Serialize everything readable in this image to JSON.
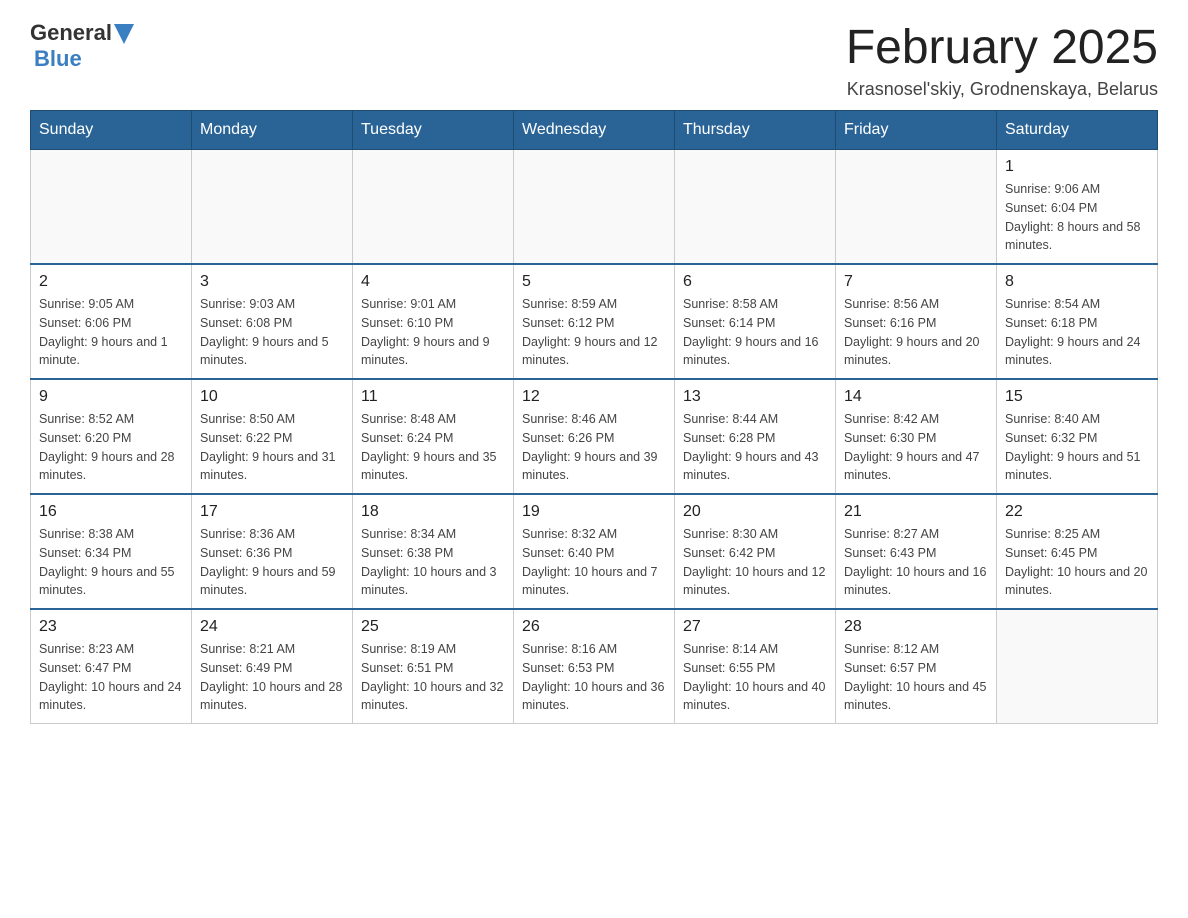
{
  "header": {
    "logo_general": "General",
    "logo_blue": "Blue",
    "month_title": "February 2025",
    "location": "Krasnosel'skiy, Grodnenskaya, Belarus"
  },
  "days_of_week": [
    "Sunday",
    "Monday",
    "Tuesday",
    "Wednesday",
    "Thursday",
    "Friday",
    "Saturday"
  ],
  "weeks": [
    {
      "days": [
        {
          "num": "",
          "info": ""
        },
        {
          "num": "",
          "info": ""
        },
        {
          "num": "",
          "info": ""
        },
        {
          "num": "",
          "info": ""
        },
        {
          "num": "",
          "info": ""
        },
        {
          "num": "",
          "info": ""
        },
        {
          "num": "1",
          "info": "Sunrise: 9:06 AM\nSunset: 6:04 PM\nDaylight: 8 hours and 58 minutes."
        }
      ]
    },
    {
      "days": [
        {
          "num": "2",
          "info": "Sunrise: 9:05 AM\nSunset: 6:06 PM\nDaylight: 9 hours and 1 minute."
        },
        {
          "num": "3",
          "info": "Sunrise: 9:03 AM\nSunset: 6:08 PM\nDaylight: 9 hours and 5 minutes."
        },
        {
          "num": "4",
          "info": "Sunrise: 9:01 AM\nSunset: 6:10 PM\nDaylight: 9 hours and 9 minutes."
        },
        {
          "num": "5",
          "info": "Sunrise: 8:59 AM\nSunset: 6:12 PM\nDaylight: 9 hours and 12 minutes."
        },
        {
          "num": "6",
          "info": "Sunrise: 8:58 AM\nSunset: 6:14 PM\nDaylight: 9 hours and 16 minutes."
        },
        {
          "num": "7",
          "info": "Sunrise: 8:56 AM\nSunset: 6:16 PM\nDaylight: 9 hours and 20 minutes."
        },
        {
          "num": "8",
          "info": "Sunrise: 8:54 AM\nSunset: 6:18 PM\nDaylight: 9 hours and 24 minutes."
        }
      ]
    },
    {
      "days": [
        {
          "num": "9",
          "info": "Sunrise: 8:52 AM\nSunset: 6:20 PM\nDaylight: 9 hours and 28 minutes."
        },
        {
          "num": "10",
          "info": "Sunrise: 8:50 AM\nSunset: 6:22 PM\nDaylight: 9 hours and 31 minutes."
        },
        {
          "num": "11",
          "info": "Sunrise: 8:48 AM\nSunset: 6:24 PM\nDaylight: 9 hours and 35 minutes."
        },
        {
          "num": "12",
          "info": "Sunrise: 8:46 AM\nSunset: 6:26 PM\nDaylight: 9 hours and 39 minutes."
        },
        {
          "num": "13",
          "info": "Sunrise: 8:44 AM\nSunset: 6:28 PM\nDaylight: 9 hours and 43 minutes."
        },
        {
          "num": "14",
          "info": "Sunrise: 8:42 AM\nSunset: 6:30 PM\nDaylight: 9 hours and 47 minutes."
        },
        {
          "num": "15",
          "info": "Sunrise: 8:40 AM\nSunset: 6:32 PM\nDaylight: 9 hours and 51 minutes."
        }
      ]
    },
    {
      "days": [
        {
          "num": "16",
          "info": "Sunrise: 8:38 AM\nSunset: 6:34 PM\nDaylight: 9 hours and 55 minutes."
        },
        {
          "num": "17",
          "info": "Sunrise: 8:36 AM\nSunset: 6:36 PM\nDaylight: 9 hours and 59 minutes."
        },
        {
          "num": "18",
          "info": "Sunrise: 8:34 AM\nSunset: 6:38 PM\nDaylight: 10 hours and 3 minutes."
        },
        {
          "num": "19",
          "info": "Sunrise: 8:32 AM\nSunset: 6:40 PM\nDaylight: 10 hours and 7 minutes."
        },
        {
          "num": "20",
          "info": "Sunrise: 8:30 AM\nSunset: 6:42 PM\nDaylight: 10 hours and 12 minutes."
        },
        {
          "num": "21",
          "info": "Sunrise: 8:27 AM\nSunset: 6:43 PM\nDaylight: 10 hours and 16 minutes."
        },
        {
          "num": "22",
          "info": "Sunrise: 8:25 AM\nSunset: 6:45 PM\nDaylight: 10 hours and 20 minutes."
        }
      ]
    },
    {
      "days": [
        {
          "num": "23",
          "info": "Sunrise: 8:23 AM\nSunset: 6:47 PM\nDaylight: 10 hours and 24 minutes."
        },
        {
          "num": "24",
          "info": "Sunrise: 8:21 AM\nSunset: 6:49 PM\nDaylight: 10 hours and 28 minutes."
        },
        {
          "num": "25",
          "info": "Sunrise: 8:19 AM\nSunset: 6:51 PM\nDaylight: 10 hours and 32 minutes."
        },
        {
          "num": "26",
          "info": "Sunrise: 8:16 AM\nSunset: 6:53 PM\nDaylight: 10 hours and 36 minutes."
        },
        {
          "num": "27",
          "info": "Sunrise: 8:14 AM\nSunset: 6:55 PM\nDaylight: 10 hours and 40 minutes."
        },
        {
          "num": "28",
          "info": "Sunrise: 8:12 AM\nSunset: 6:57 PM\nDaylight: 10 hours and 45 minutes."
        },
        {
          "num": "",
          "info": ""
        }
      ]
    }
  ]
}
